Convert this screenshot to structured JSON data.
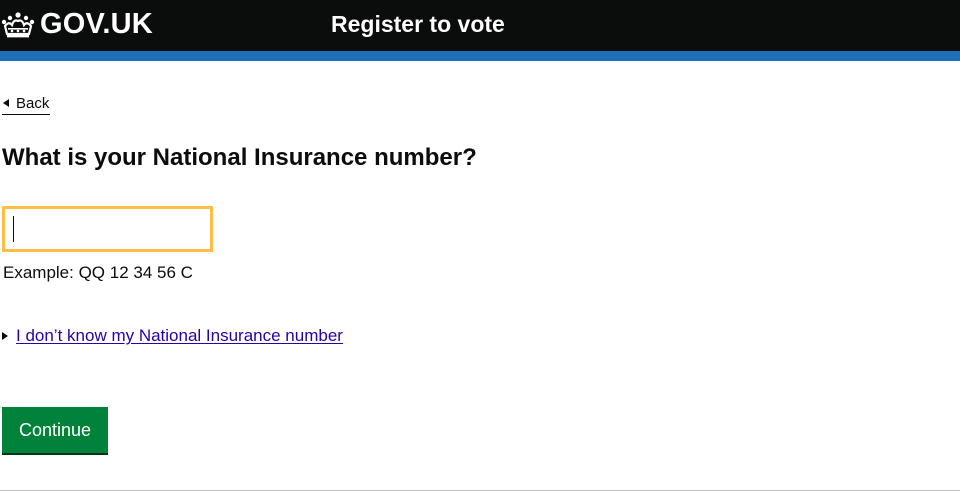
{
  "header": {
    "logo_text": "GOV.UK",
    "logo_icon": "crown-icon",
    "service_name": "Register to vote",
    "background_color": "#0b0c0c",
    "stripe_color": "#1d70b8"
  },
  "back_link": {
    "label": "Back",
    "icon": "chevron-left-icon"
  },
  "question": {
    "title": "What is your National Insurance number?"
  },
  "nino_input": {
    "value": "",
    "focus_color": "#ffbf47"
  },
  "hint": {
    "text": "Example: QQ 12 34 56 C"
  },
  "details": {
    "summary": "I don’t know my National Insurance number",
    "icon": "triangle-right-icon",
    "link_color": "#2b00a8"
  },
  "actions": {
    "continue_label": "Continue",
    "button_color": "#00823b"
  }
}
